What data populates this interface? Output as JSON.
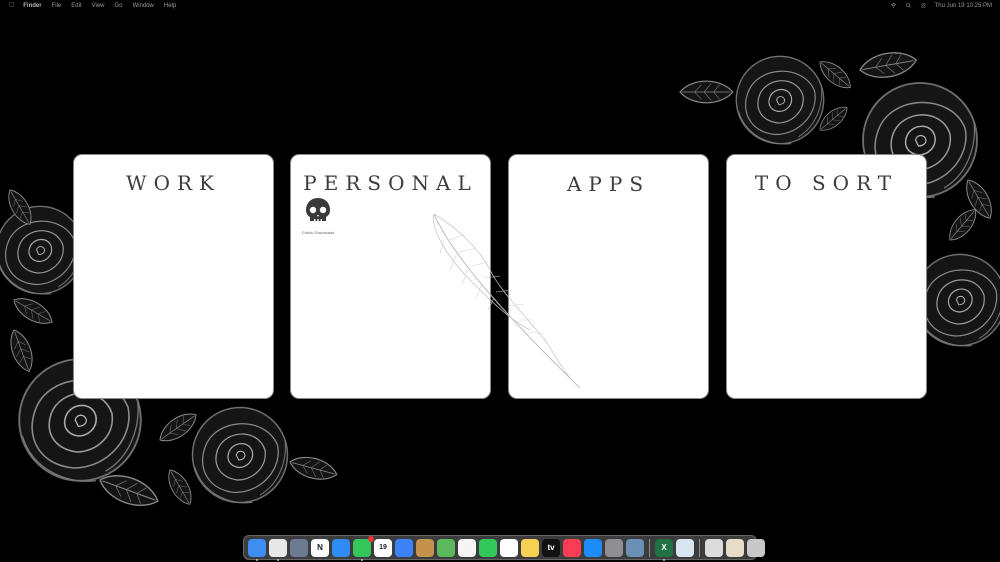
{
  "menubar": {
    "apple_icon": "apple-logo-icon",
    "items": [
      "Finder",
      "File",
      "Edit",
      "View",
      "Go",
      "Window",
      "Help"
    ],
    "clock": "Thu Jun 19  10:25 PM",
    "status_icons": [
      "wifi-icon",
      "search-icon",
      "control-center-icon"
    ]
  },
  "cards": [
    {
      "title": "WORK"
    },
    {
      "title": "PERSONAL"
    },
    {
      "title": "APPS"
    },
    {
      "title": "TO SORT"
    }
  ],
  "desktop_icon": {
    "icon": "skull-icon",
    "label": "Gothic Downloads"
  },
  "dock": {
    "apps": [
      {
        "name": "Finder",
        "icon": "finder-icon",
        "color": "#3d8ef0",
        "running": true
      },
      {
        "name": "Chrome",
        "icon": "chrome-icon",
        "color": "#e8e8e8",
        "running": true
      },
      {
        "name": "Launchpad",
        "icon": "launchpad-icon",
        "color": "#6c7a92",
        "running": false
      },
      {
        "name": "Notion",
        "icon": "notion-icon",
        "color": "#ffffff",
        "glyph": "N",
        "running": false
      },
      {
        "name": "Safari",
        "icon": "safari-icon",
        "color": "#2f8cf2",
        "running": false
      },
      {
        "name": "Messages",
        "icon": "messages-icon",
        "color": "#35c759",
        "running": true,
        "badge": true
      },
      {
        "name": "Calendar",
        "icon": "calendar-icon",
        "color": "#ffffff",
        "glyph": "19",
        "running": false
      },
      {
        "name": "Mail",
        "icon": "mail-icon",
        "color": "#3b82f6",
        "running": false
      },
      {
        "name": "Notebook",
        "icon": "notebook-icon",
        "color": "#c4924a",
        "running": false
      },
      {
        "name": "Maps",
        "icon": "maps-icon",
        "color": "#5cb85c",
        "running": false
      },
      {
        "name": "Photos",
        "icon": "photos-icon",
        "color": "#f5f5f5",
        "running": false
      },
      {
        "name": "FaceTime",
        "icon": "facetime-icon",
        "color": "#34c759",
        "running": false
      },
      {
        "name": "Reminders",
        "icon": "reminders-icon",
        "color": "#ffffff",
        "running": false
      },
      {
        "name": "Notes",
        "icon": "notes-icon",
        "color": "#f7d154",
        "running": false
      },
      {
        "name": "Apple TV",
        "icon": "appletv-icon",
        "color": "#111111",
        "glyph": "tv",
        "running": false
      },
      {
        "name": "Music",
        "icon": "music-icon",
        "color": "#fa3d57",
        "running": false
      },
      {
        "name": "App Store",
        "icon": "appstore-icon",
        "color": "#1d8cf8",
        "running": false
      },
      {
        "name": "System Settings",
        "icon": "settings-icon",
        "color": "#8e8e93",
        "running": false
      },
      {
        "name": "Preview",
        "icon": "preview-icon",
        "color": "#6b8fb5",
        "running": false
      }
    ],
    "apps_after_separator": [
      {
        "name": "Excel",
        "icon": "excel-icon",
        "color": "#1f7244",
        "glyph": "X",
        "running": true
      },
      {
        "name": "Preview Doc",
        "icon": "document-icon",
        "color": "#d9e6f2",
        "running": false
      }
    ],
    "stacks": [
      {
        "name": "Screenshot",
        "icon": "screenshot-stack-icon",
        "color": "#dcdcdc"
      },
      {
        "name": "Downloads",
        "icon": "downloads-stack-icon",
        "color": "#e6dcc8"
      },
      {
        "name": "Trash",
        "icon": "trash-icon",
        "color": "#c8c8c8"
      }
    ]
  }
}
